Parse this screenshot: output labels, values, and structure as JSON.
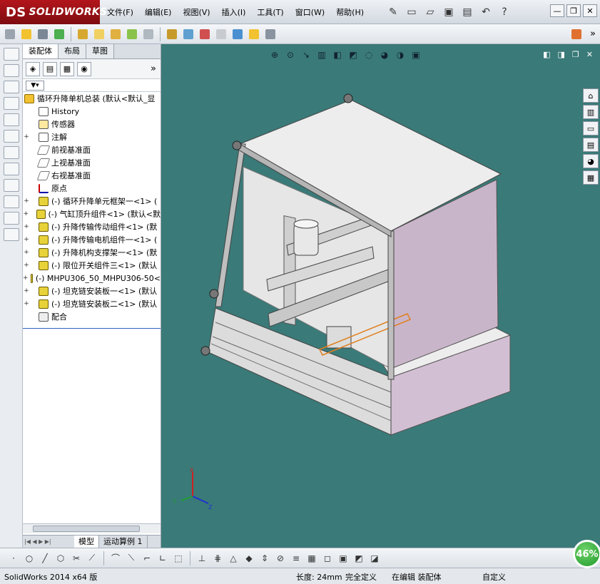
{
  "app": {
    "brand_prefix": "DS",
    "brand": "SOLIDWORKS"
  },
  "menu": [
    "文件(F)",
    "编辑(E)",
    "视图(V)",
    "插入(I)",
    "工具(T)",
    "窗口(W)",
    "帮助(H)"
  ],
  "help_glyph": "?",
  "window_controls": {
    "minimize": "—",
    "restore": "❐",
    "close": "✕"
  },
  "panel_tabs": [
    "装配体",
    "布局",
    "草图"
  ],
  "tree": {
    "root": "循环升降单机总装 (默认<默认_显",
    "items": [
      {
        "label": "History",
        "icon": "history-icon"
      },
      {
        "label": "传感器",
        "icon": "sensor-icon"
      },
      {
        "label": "注解",
        "icon": "annotation-icon",
        "expand": "+"
      },
      {
        "label": "前视基准面",
        "icon": "plane-icon"
      },
      {
        "label": "上视基准面",
        "icon": "plane-icon"
      },
      {
        "label": "右视基准面",
        "icon": "plane-icon"
      },
      {
        "label": "原点",
        "icon": "origin-icon"
      },
      {
        "label": "(-) 循环升降单元框架一<1> (",
        "icon": "component-icon",
        "expand": "+"
      },
      {
        "label": "(-) 气缸顶升组件<1> (默认<默",
        "icon": "component-icon",
        "expand": "+"
      },
      {
        "label": "(-) 升降传输传动组件<1> (默",
        "icon": "component-icon",
        "expand": "+"
      },
      {
        "label": "(-) 升降传输电机组件一<1> (",
        "icon": "component-icon",
        "expand": "+"
      },
      {
        "label": "(-) 升降机构支撑架一<1> (默",
        "icon": "component-icon",
        "expand": "+"
      },
      {
        "label": "(-) 限位开关组件三<1> (默认",
        "icon": "component-icon",
        "expand": "+"
      },
      {
        "label": "(-) MHPU306_50_MHPU306-50<",
        "icon": "component-icon",
        "expand": "+"
      },
      {
        "label": "(-) 坦克链安装板一<1> (默认",
        "icon": "component-icon",
        "expand": "+"
      },
      {
        "label": "(-) 坦克链安装板二<1> (默认",
        "icon": "component-icon",
        "expand": "+"
      },
      {
        "label": "配合",
        "icon": "mate-icon"
      }
    ]
  },
  "bottom_tabs": [
    "模型",
    "运动算例 1"
  ],
  "triad": {
    "x": "X",
    "y": "Y",
    "z": "Z"
  },
  "status": {
    "version": "SolidWorks 2014 x64 版",
    "length": "长度: 24mm",
    "definition": "完全定义",
    "editing": "在编辑 装配体",
    "custom": "自定义"
  },
  "zoom": "46%",
  "colors": {
    "viewport_bg": "#3a7a78",
    "brand_red": "#b3151b",
    "panel_purple": "#c8b8c8"
  }
}
